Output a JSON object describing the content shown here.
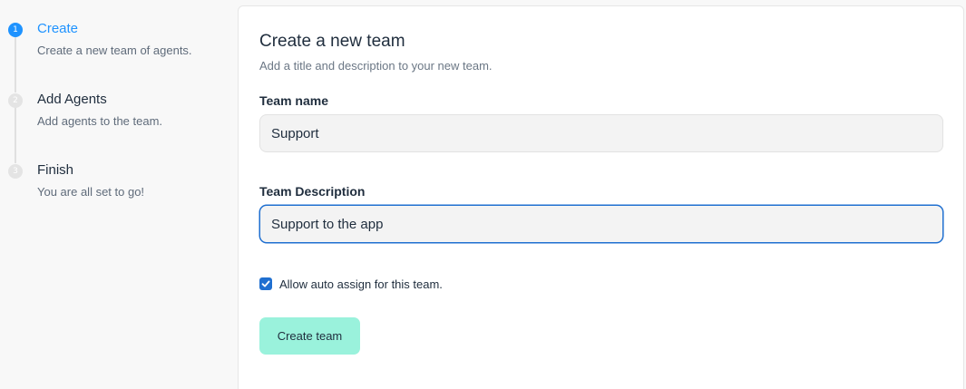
{
  "stepper": {
    "steps": [
      {
        "number": "1",
        "title": "Create",
        "description": "Create a new team of agents.",
        "active": true
      },
      {
        "number": "2",
        "title": "Add Agents",
        "description": "Add agents to the team.",
        "active": false
      },
      {
        "number": "3",
        "title": "Finish",
        "description": "You are all set to go!",
        "active": false
      }
    ]
  },
  "form": {
    "title": "Create a new team",
    "subtitle": "Add a title and description to your new team.",
    "team_name_label": "Team name",
    "team_name_value": "Support",
    "team_description_label": "Team Description",
    "team_description_value": "Support to the app",
    "auto_assign_label": "Allow auto assign for this team.",
    "auto_assign_checked": true,
    "submit_label": "Create team"
  },
  "colors": {
    "accent": "#1f93ff",
    "button_bg": "#9af2dc",
    "checkbox": "#1f6fd0"
  }
}
